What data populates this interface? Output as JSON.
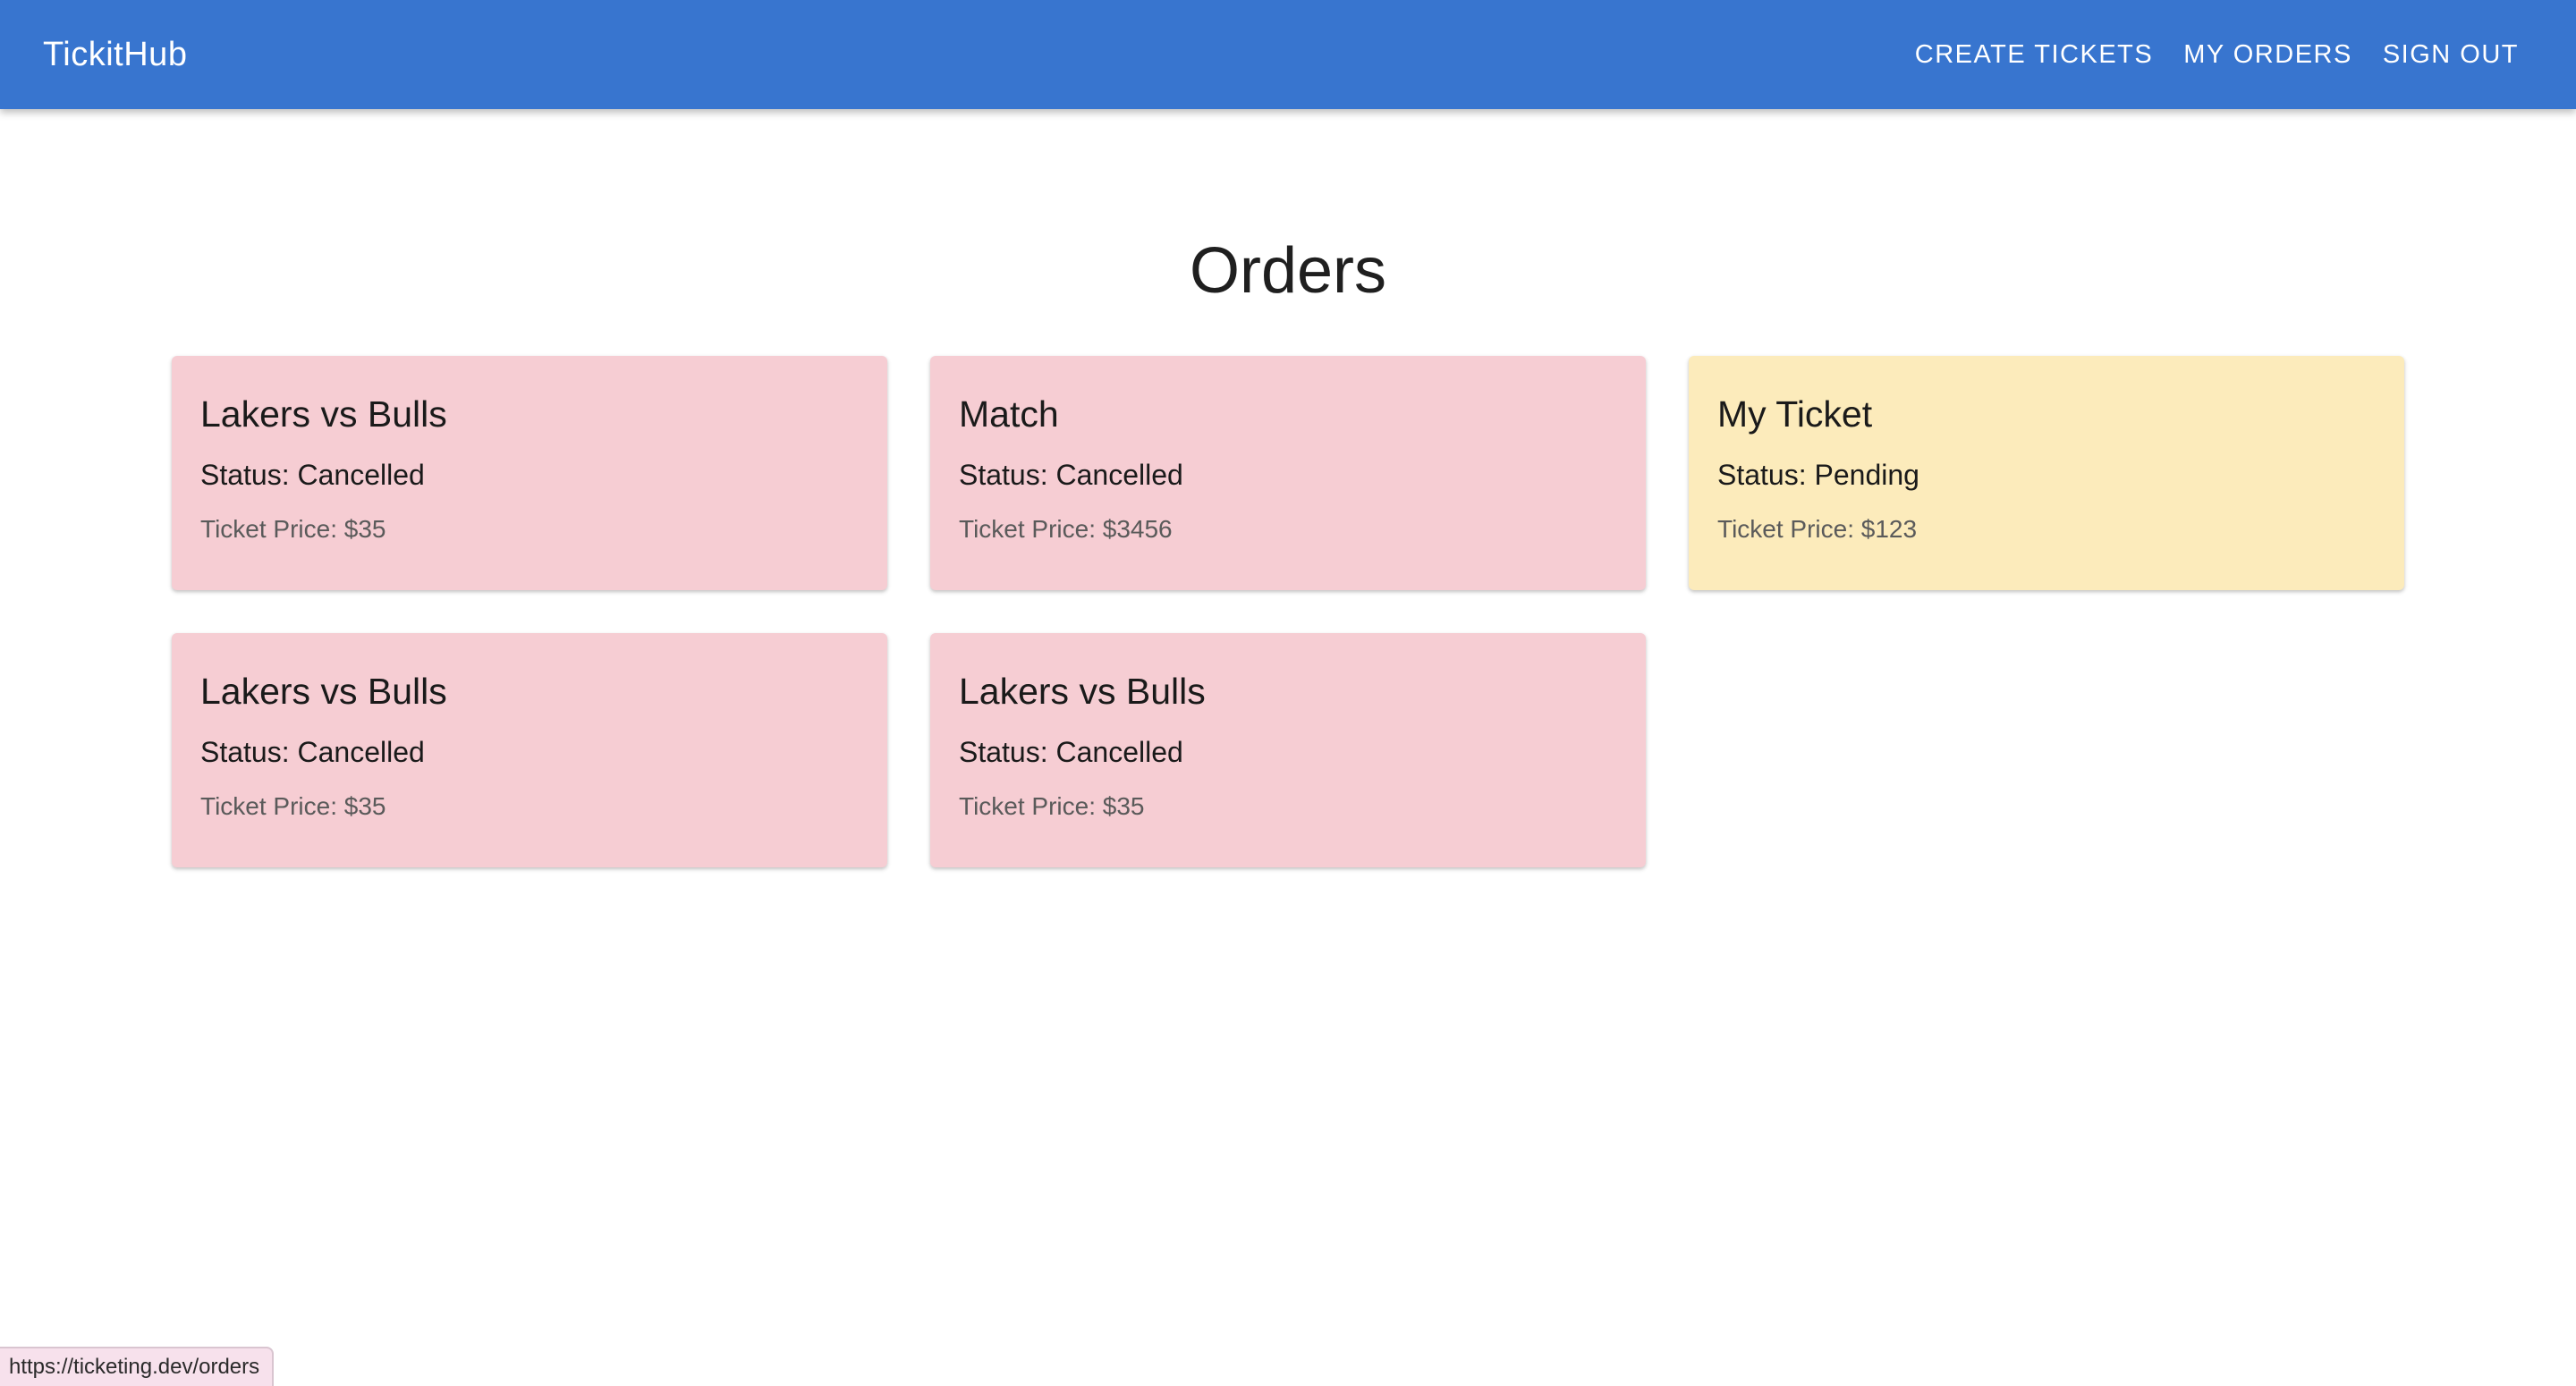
{
  "header": {
    "brand": "TickitHub",
    "nav": [
      {
        "label": "CREATE TICKETS"
      },
      {
        "label": "MY ORDERS"
      },
      {
        "label": "SIGN OUT"
      }
    ],
    "accent_color": "#3875cf"
  },
  "page": {
    "title": "Orders"
  },
  "orders": [
    {
      "title": "Lakers vs Bulls",
      "status": "Status: Cancelled",
      "price": "Ticket Price: $35",
      "state": "cancelled",
      "color": "#f6cdd3"
    },
    {
      "title": "Match",
      "status": "Status: Cancelled",
      "price": "Ticket Price: $3456",
      "state": "cancelled",
      "color": "#f6cdd3"
    },
    {
      "title": "My Ticket",
      "status": "Status: Pending",
      "price": "Ticket Price: $123",
      "state": "pending",
      "color": "#fcebbb"
    },
    {
      "title": "Lakers vs Bulls",
      "status": "Status: Cancelled",
      "price": "Ticket Price: $35",
      "state": "cancelled",
      "color": "#f6cdd3"
    },
    {
      "title": "Lakers vs Bulls",
      "status": "Status: Cancelled",
      "price": "Ticket Price: $35",
      "state": "cancelled",
      "color": "#f6cdd3"
    }
  ],
  "status_bar": {
    "url": "https://ticketing.dev/orders"
  }
}
